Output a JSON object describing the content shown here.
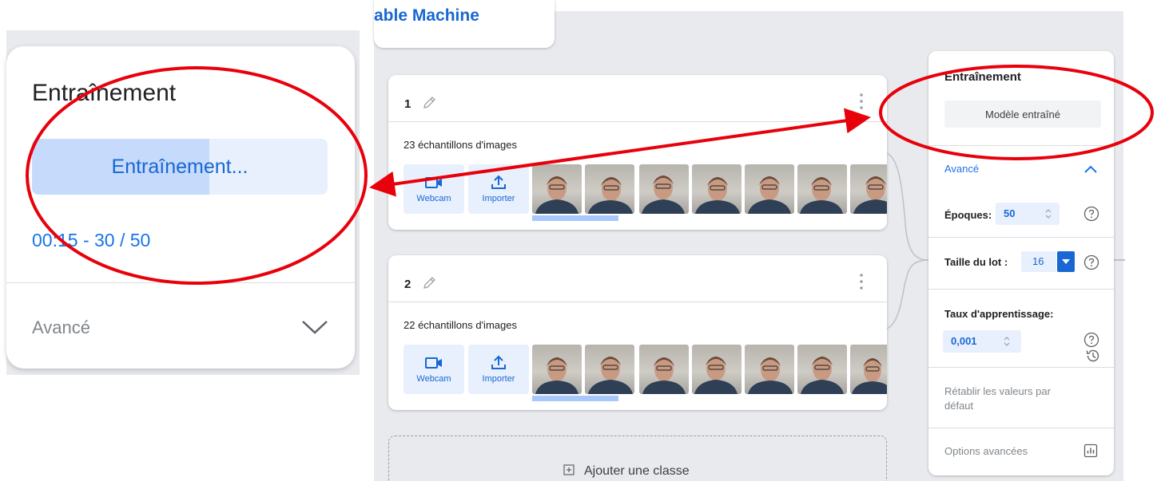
{
  "zoom": {
    "title": "Entraînement",
    "button_label": "Entraînement...",
    "progress": 0.6,
    "timer": "00:15 - 30 / 50",
    "advanced_label": "Avancé"
  },
  "header": {
    "logo_text": "able Machine"
  },
  "classes": [
    {
      "name": "1",
      "samples_label": "23 échantillons d'images"
    },
    {
      "name": "2",
      "samples_label": "22 échantillons d'images"
    }
  ],
  "tools": {
    "webcam_label": "Webcam",
    "upload_label": "Importer"
  },
  "add_class_label": "Ajouter une classe",
  "training": {
    "title": "Entraînement",
    "trained_button": "Modèle entraîné",
    "advanced_label": "Avancé",
    "epochs_label": "Époques:",
    "epochs_value": "50",
    "batch_label": "Taille du lot :",
    "batch_value": "16",
    "lr_label": "Taux d'apprentissage:",
    "lr_value": "0,001",
    "reset_label": "Rétablir les valeurs par défaut",
    "advanced_options_label": "Options avancées"
  },
  "colors": {
    "accent": "#1a73e8",
    "annotation": "#e8000b",
    "progress_fill": "#c6dafc",
    "button_bg": "#e8f0fe"
  },
  "icons": [
    "pencil-icon",
    "kebab-icon",
    "webcam-icon",
    "upload-icon",
    "plus-box-icon",
    "chevron-up-icon",
    "chevron-down-icon",
    "help-icon",
    "history-icon",
    "bar-chart-icon",
    "dropdown-arrow-icon"
  ]
}
